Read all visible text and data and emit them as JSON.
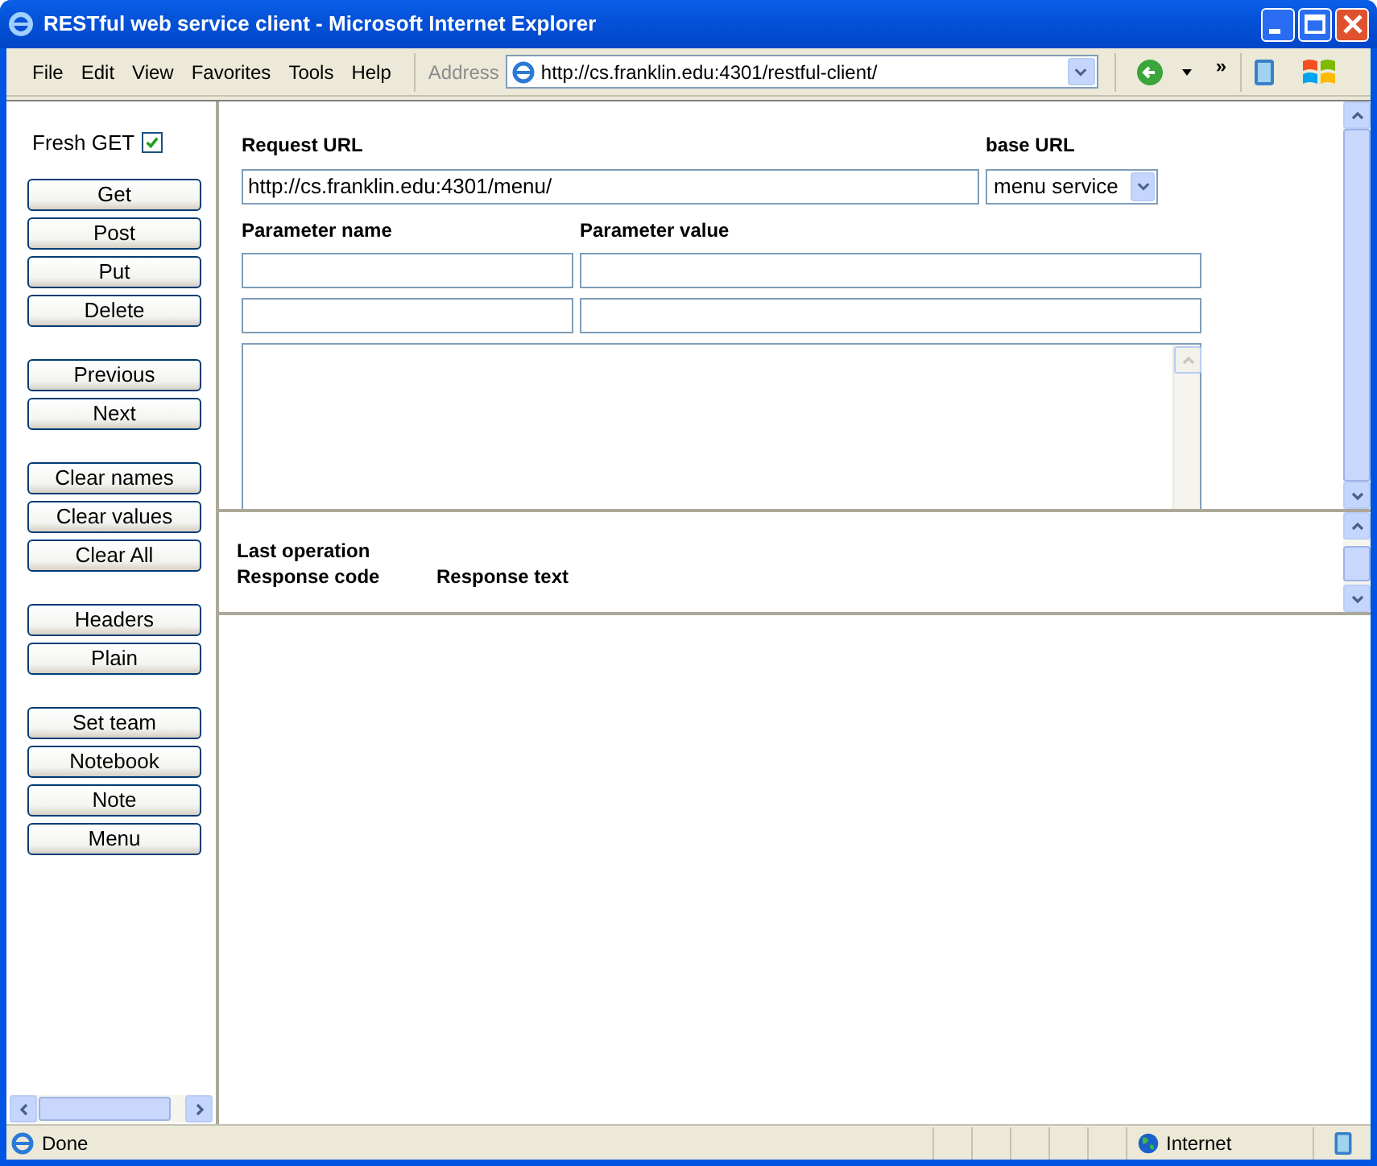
{
  "window": {
    "title": "RESTful web service client - Microsoft Internet Explorer"
  },
  "menu": [
    "File",
    "Edit",
    "View",
    "Favorites",
    "Tools",
    "Help"
  ],
  "address": {
    "label": "Address",
    "value": "http://cs.franklin.edu:4301/restful-client/"
  },
  "toolbar": {
    "chevron": "»"
  },
  "sidebar": {
    "fresh_get": {
      "label": "Fresh GET",
      "checked": true
    },
    "button_groups": [
      [
        "Get",
        "Post",
        "Put",
        "Delete"
      ],
      [
        "Previous",
        "Next"
      ],
      [
        "Clear names",
        "Clear values",
        "Clear All"
      ],
      [
        "Headers",
        "Plain"
      ],
      [
        "Set team",
        "Notebook",
        "Note",
        "Menu"
      ]
    ]
  },
  "request": {
    "url_label": "Request URL",
    "url_value": "http://cs.franklin.edu:4301/menu/",
    "base_label": "base URL",
    "base_value": "menu service",
    "param_name_label": "Parameter name",
    "param_value_label": "Parameter value"
  },
  "response": {
    "last_operation_label": "Last operation",
    "code_label": "Response code",
    "text_label": "Response text"
  },
  "status_bar": {
    "text": "Done",
    "zone": "Internet"
  }
}
